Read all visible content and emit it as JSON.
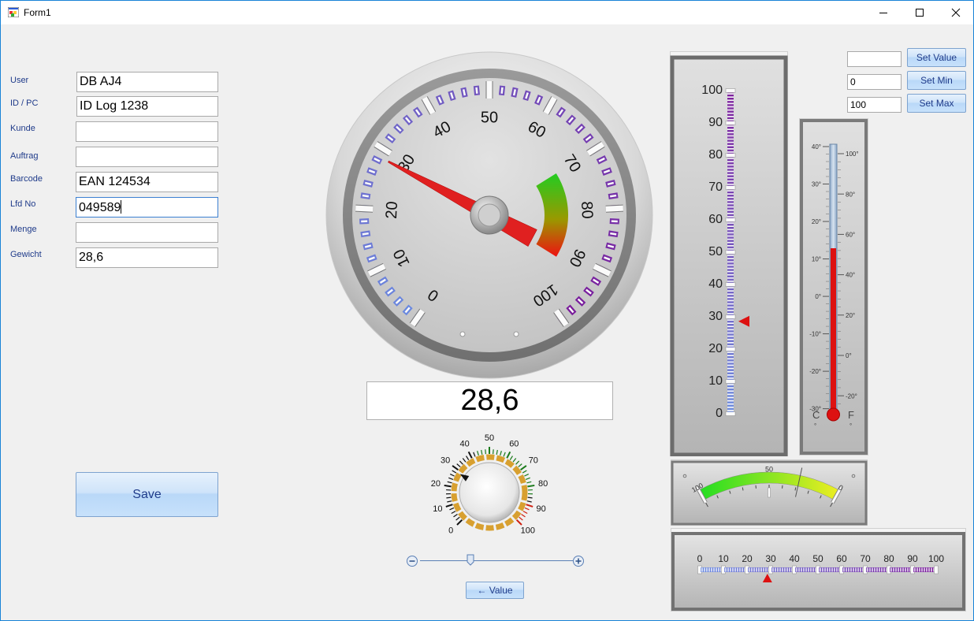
{
  "window": {
    "title": "Form1",
    "icon": "app-icon"
  },
  "controls": {
    "minimize": "minimize-icon",
    "maximize": "maximize-icon",
    "close": "close-icon"
  },
  "form": {
    "fields": [
      {
        "label": "User",
        "value": "DB AJ4"
      },
      {
        "label": "ID / PC",
        "value": "ID Log 1238"
      },
      {
        "label": "Kunde",
        "value": ""
      },
      {
        "label": "Auftrag",
        "value": ""
      },
      {
        "label": "Barcode",
        "value": "EAN 124534"
      },
      {
        "label": "Lfd No",
        "value": "049589"
      },
      {
        "label": "Menge",
        "value": ""
      },
      {
        "label": "Gewicht",
        "value": "28,6"
      }
    ],
    "save_label": "Save"
  },
  "main_gauge": {
    "value": 28.6,
    "min": 0,
    "max": 100,
    "tick_labels": [
      "0",
      "10",
      "20",
      "30",
      "40",
      "50",
      "60",
      "70",
      "80",
      "90",
      "100"
    ],
    "accent_low": "#6a8be0",
    "accent_high": "#7a1a9a",
    "needle_color": "#e02020"
  },
  "readout": {
    "value": "28,6"
  },
  "knob": {
    "value": 28.6,
    "tick_labels": [
      "0",
      "10",
      "20",
      "30",
      "40",
      "50",
      "60",
      "70",
      "80",
      "90",
      "100"
    ]
  },
  "slider": {
    "value_fraction": 0.286,
    "value_button_label": "← Value",
    "minus_icon": "minus-circle-icon",
    "plus_icon": "plus-circle-icon"
  },
  "vertical_gauge": {
    "value": 28.6,
    "tick_labels": [
      "100",
      "90",
      "80",
      "70",
      "60",
      "50",
      "40",
      "30",
      "20",
      "10",
      "0"
    ]
  },
  "set_controls": {
    "value_input": "",
    "min_input": "0",
    "max_input": "100",
    "set_value_label": "Set  Value",
    "set_min_label": "Set Min",
    "set_max_label": "Set Max"
  },
  "thermometer": {
    "celsius_labels": [
      "40°",
      "30°",
      "20°",
      "10°",
      "0°",
      "-10°",
      "-20°",
      "-30°"
    ],
    "fahrenheit_labels": [
      "100°",
      "80°",
      "60°",
      "40°",
      "20°",
      "0°",
      "-20°"
    ],
    "c_label": "C",
    "f_label": "F",
    "degree_mark": "°",
    "fill_fraction": 0.615
  },
  "arc_meter": {
    "labels": [
      "100",
      "50",
      "0"
    ],
    "value": 28.6
  },
  "horizontal_gauge": {
    "value": 28.6,
    "tick_labels": [
      "0",
      "10",
      "20",
      "30",
      "40",
      "50",
      "60",
      "70",
      "80",
      "90",
      "100"
    ]
  }
}
